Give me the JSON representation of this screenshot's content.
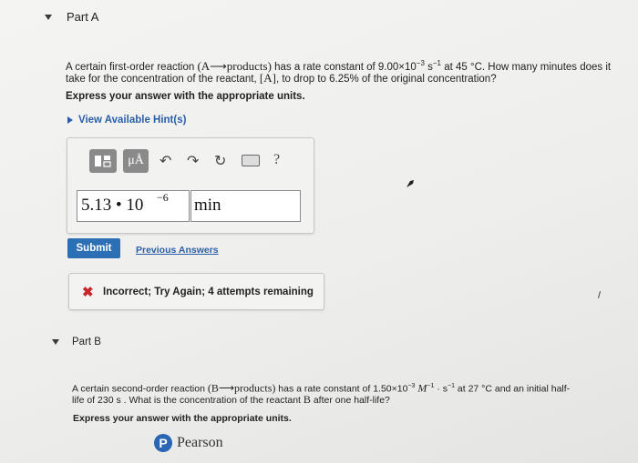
{
  "part_a": {
    "title": "Part A",
    "question_line1_a": "A certain first-order reaction ",
    "question_line1_formula": "(A⟶products)",
    "question_line1_b": " has a rate constant of 9.00×10",
    "question_line1_exp": "−3",
    "question_line1_c": " s",
    "question_line1_exp2": "−1",
    "question_line1_d": " at 45 °C. How many minutes does it",
    "question_line2_a": "take for the concentration of the reactant, ",
    "question_line2_species": "[A]",
    "question_line2_b": ", to drop to 6.25% of the original concentration?",
    "instruction": "Express your answer with the appropriate units.",
    "hint_link": "View Available Hint(s)",
    "toolbar": {
      "templates_icon": "templates-icon",
      "units_label": "μÅ",
      "undo_icon": "undo-icon",
      "redo_icon": "redo-icon",
      "reset_icon": "reset-icon",
      "keyboard_icon": "keyboard-icon",
      "help_label": "?"
    },
    "answer_value": "5.13 • 10",
    "answer_exponent": "−6",
    "answer_unit": "min",
    "submit_label": "Submit",
    "previous_answers_label": "Previous Answers",
    "feedback_mark": "✖",
    "feedback_text": "Incorrect; Try Again; 4 attempts remaining"
  },
  "part_b": {
    "title": "Part B",
    "question_line1_a": "A certain second-order reaction ",
    "question_line1_formula": "(B⟶products)",
    "question_line1_b": " has a rate constant of 1.50×10",
    "question_line1_exp": "−3",
    "question_line1_c": " M",
    "question_line1_exp2": "−1",
    "question_line1_d": " · s",
    "question_line1_exp3": "−1",
    "question_line1_e": " at 27 °C and an initial half-",
    "question_line2_a": "life of 230 s . What is the concentration of the reactant ",
    "question_line2_species": "B",
    "question_line2_b": " after one half-life?",
    "instruction": "Express your answer with the appropriate units."
  },
  "footer": {
    "brand": "Pearson",
    "brand_logo_letter": "P"
  },
  "colors": {
    "accent": "#2d6fb5",
    "link": "#2a5fa8",
    "error": "#c8272e",
    "toolbar_button": "#8a8a8a"
  }
}
